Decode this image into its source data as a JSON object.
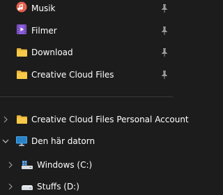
{
  "quick_access": [
    {
      "label": "Musik",
      "icon": "music-icon",
      "pinned": true
    },
    {
      "label": "Filmer",
      "icon": "video-icon",
      "pinned": true
    },
    {
      "label": "Download",
      "icon": "folder-icon",
      "pinned": true
    },
    {
      "label": "Creative Cloud Files",
      "icon": "folder-icon",
      "pinned": true
    }
  ],
  "tree": [
    {
      "label": "Creative Cloud Files Personal Account",
      "icon": "folder-icon",
      "expanded": false
    },
    {
      "label": "Den här datorn",
      "icon": "computer-icon",
      "expanded": true
    },
    {
      "label": "Windows (C:)",
      "icon": "windows-drive-icon",
      "expanded": false
    },
    {
      "label": "Stuffs (D:)",
      "icon": "drive-icon",
      "expanded": false
    }
  ],
  "colors": {
    "background": "#1c1c1c",
    "folder": "#f8c948",
    "music": "#e5624e",
    "video": "#8a5cd8",
    "computer": "#4aa7e8",
    "text": "#ffffff",
    "muted": "#9a9a9a"
  }
}
